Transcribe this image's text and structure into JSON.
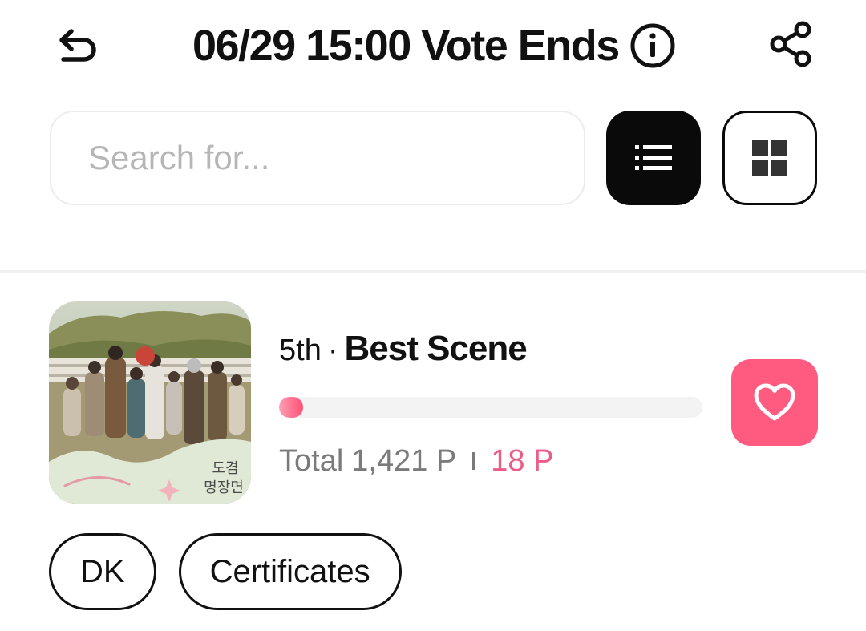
{
  "header": {
    "title": "06/29 15:00 Vote Ends",
    "icons": {
      "back": "back-arrow-icon",
      "info": "info-icon",
      "share": "share-icon"
    }
  },
  "search": {
    "placeholder": "Search for...",
    "value": ""
  },
  "view_toggle": {
    "selected": "list",
    "options": [
      {
        "id": "list",
        "icon": "list-icon"
      },
      {
        "id": "grid",
        "icon": "grid-icon"
      }
    ]
  },
  "candidate": {
    "rank": "5th",
    "separator": "·",
    "category": "Best Scene",
    "progress_fraction": 0.01,
    "total_label": "Total",
    "total_value": "1,421 P",
    "my_points": "18 P",
    "thumbnail_title_lines": [
      "도겸",
      "명장면"
    ],
    "tags": [
      "DK",
      "Certificates"
    ]
  },
  "colors": {
    "accent": "#ff5a80",
    "points_text": "#ec5c86",
    "muted_text": "#7b7b7b",
    "active_toggle": "#0a0a0a"
  }
}
